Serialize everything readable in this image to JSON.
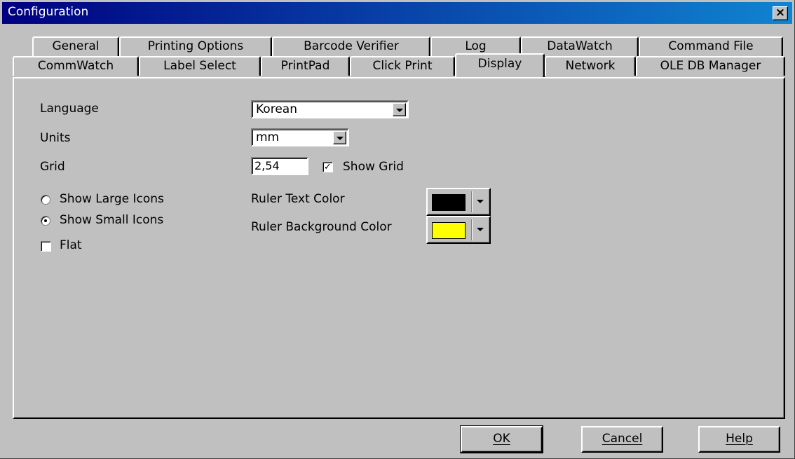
{
  "window": {
    "title": "Configuration",
    "close_label": "×"
  },
  "tabs_row1": [
    {
      "label": "General"
    },
    {
      "label": "Printing Options"
    },
    {
      "label": "Barcode Verifier"
    },
    {
      "label": "Log"
    },
    {
      "label": "DataWatch"
    },
    {
      "label": "Command File"
    }
  ],
  "tabs_row2": [
    {
      "label": "CommWatch"
    },
    {
      "label": "Label Select"
    },
    {
      "label": "PrintPad"
    },
    {
      "label": "Click Print"
    },
    {
      "label": "Display",
      "active": true
    },
    {
      "label": "Network"
    },
    {
      "label": "OLE DB Manager"
    }
  ],
  "display": {
    "language_label": "Language",
    "language_value": "Korean",
    "units_label": "Units",
    "units_value": "mm",
    "grid_label": "Grid",
    "grid_value": "2,54",
    "show_grid_label": "Show Grid",
    "show_grid_checked": true,
    "show_large_icons_label": "Show Large Icons",
    "show_small_icons_label": "Show Small Icons",
    "icon_size_selected": "small",
    "flat_label": "Flat",
    "flat_checked": false,
    "ruler_text_color_label": "Ruler Text Color",
    "ruler_text_color": "#000000",
    "ruler_bg_color_label": "Ruler Background Color",
    "ruler_bg_color": "#ffff00"
  },
  "buttons": {
    "ok": "OK",
    "cancel": "Cancel",
    "help": "Help"
  },
  "checkmark": "✓"
}
